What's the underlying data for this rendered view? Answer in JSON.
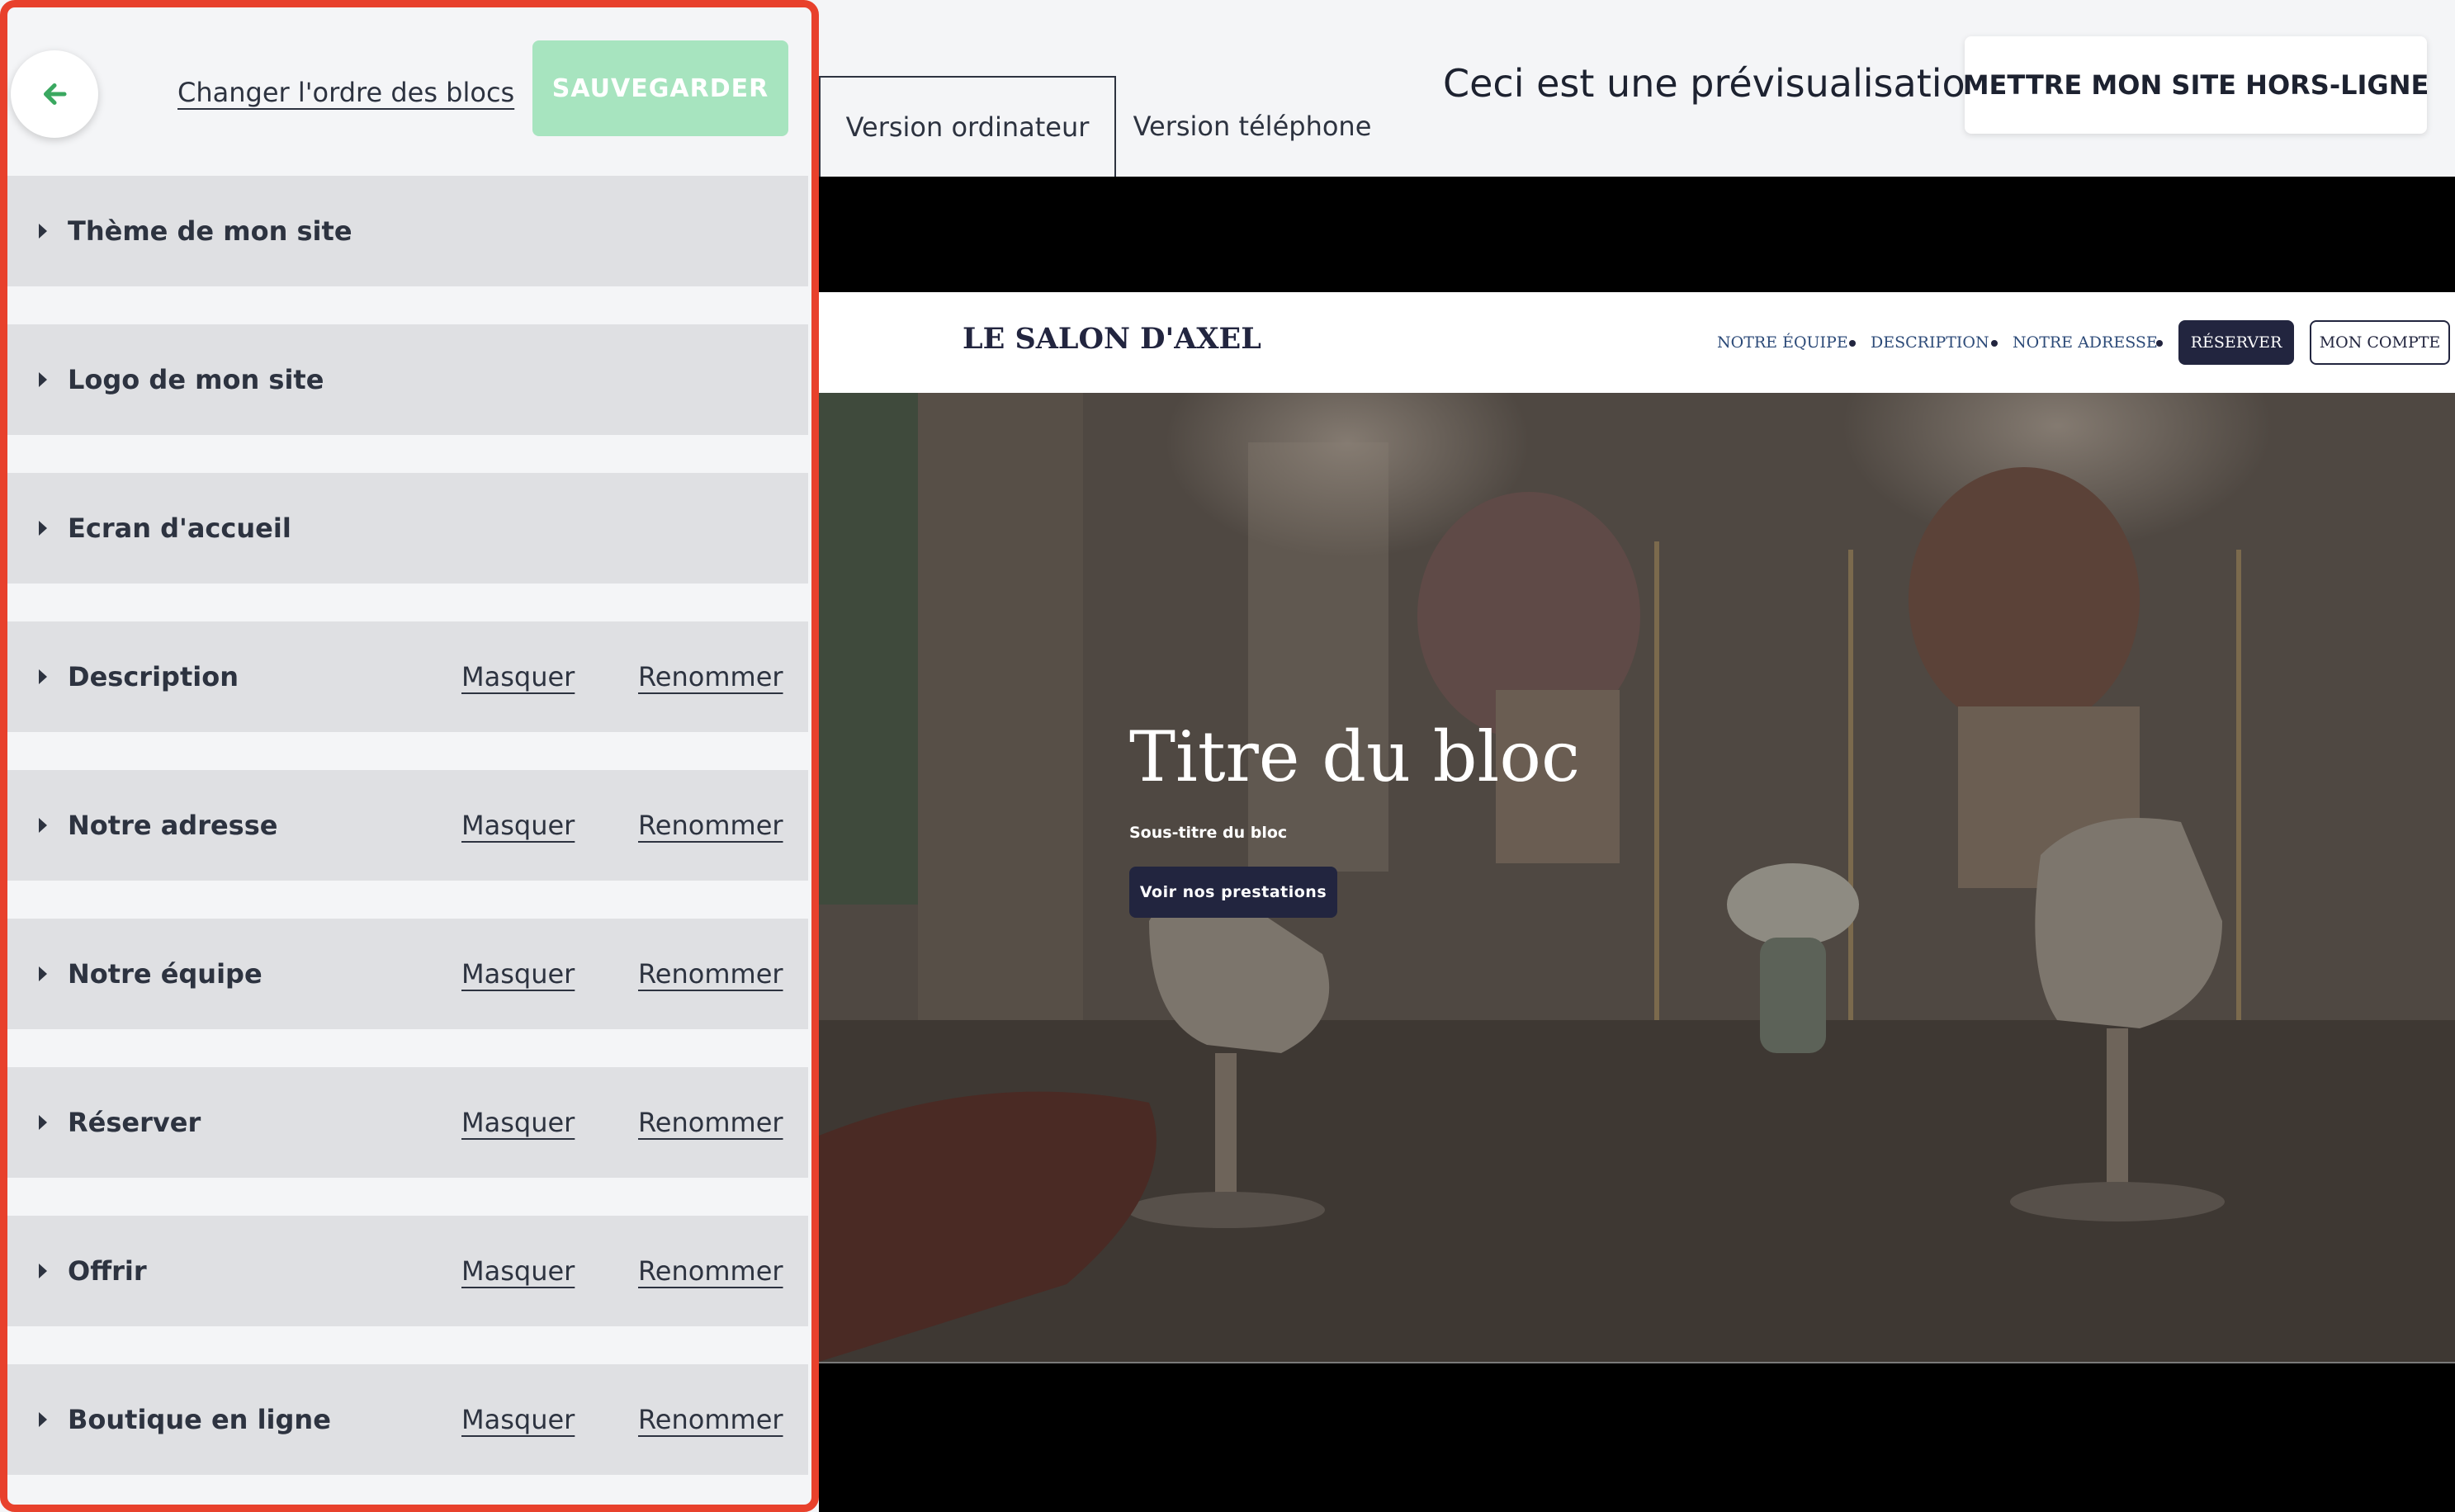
{
  "panel": {
    "reorder_label": "Changer l'ordre des blocs",
    "save_label": "SAUVEGARDER",
    "blocks": [
      {
        "title": "Thème de mon site",
        "hide": "",
        "rename": ""
      },
      {
        "title": "Logo de mon site",
        "hide": "",
        "rename": ""
      },
      {
        "title": "Ecran d'accueil",
        "hide": "",
        "rename": ""
      },
      {
        "title": "Description",
        "hide": "Masquer",
        "rename": "Renommer"
      },
      {
        "title": "Notre adresse",
        "hide": "Masquer",
        "rename": "Renommer"
      },
      {
        "title": "Notre équipe",
        "hide": "Masquer",
        "rename": "Renommer"
      },
      {
        "title": "Réserver",
        "hide": "Masquer",
        "rename": "Renommer"
      },
      {
        "title": "Offrir",
        "hide": "Masquer",
        "rename": "Renommer"
      },
      {
        "title": "Boutique en ligne",
        "hide": "Masquer",
        "rename": "Renommer"
      }
    ]
  },
  "topbar": {
    "tab_desktop": "Version ordinateur",
    "tab_mobile": "Version téléphone",
    "preview_label": "Ceci est une prévisualisation",
    "offline_button": "METTRE MON SITE HORS-LIGNE"
  },
  "site": {
    "logo": "LE SALON D'AXEL",
    "nav": {
      "team": "NOTRE ÉQUIPE",
      "description": "DESCRIPTION",
      "address": "NOTRE ADRESSE",
      "reserve": "RÉSERVER",
      "account": "MON COMPTE"
    },
    "hero": {
      "title": "Titre du bloc",
      "subtitle": "Sous-titre du bloc",
      "button": "Voir nos prestations"
    }
  },
  "colors": {
    "panel_border": "#e8412c",
    "save_button": "#a7e4bf",
    "brand_dark": "#22253f",
    "nav_link": "#2c4a78"
  },
  "icons": {
    "back": "arrow-left-icon",
    "expand": "caret-right-icon"
  }
}
